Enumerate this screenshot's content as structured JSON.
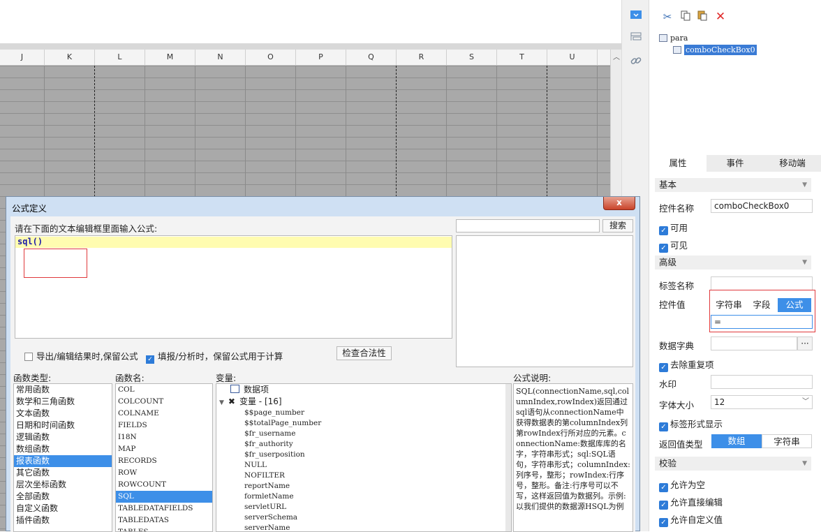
{
  "sheet": {
    "columns": [
      "J",
      "K",
      "L",
      "M",
      "N",
      "O",
      "P",
      "Q",
      "R",
      "S",
      "T",
      "U"
    ]
  },
  "middle_toolbar": {
    "icons": [
      "combo-widget-icon",
      "widget-list-icon",
      "link-icon"
    ]
  },
  "right_panel": {
    "toolbar_icons": [
      "cut-icon",
      "copy-icon",
      "paste-icon",
      "delete-icon"
    ],
    "tree": {
      "root": "para",
      "child": "comboCheckBox0"
    },
    "tabs": [
      "属性",
      "事件",
      "移动端"
    ],
    "basic": {
      "section": "基本",
      "name_label": "控件名称",
      "name_value": "comboCheckBox0",
      "enabled": "可用",
      "visible": "可见"
    },
    "advanced": {
      "section": "高级",
      "tag_name_label": "标签名称",
      "control_value_label": "控件值",
      "value_modes": [
        "字符串",
        "字段",
        "公式"
      ],
      "formula_value": "=",
      "dict_label": "数据字典",
      "dict_button": "···",
      "dedupe": "去除重复项",
      "watermark_label": "水印",
      "font_size_label": "字体大小",
      "font_size_value": "12",
      "tag_display": "标签形式显示",
      "return_type_label": "返回值类型",
      "return_types": [
        "数组",
        "字符串"
      ]
    },
    "validation": {
      "section": "校验",
      "allow_empty": "允许为空",
      "allow_edit": "允许直接编辑",
      "allow_custom": "允许自定义值"
    }
  },
  "dialog": {
    "title": "公式定义",
    "close": "x",
    "prompt": "请在下面的文本编辑框里面输入公式:",
    "formula": "sql()",
    "search_button": "搜索",
    "keep_formula_export": "导出/编辑结果时,保留公式",
    "keep_formula_fill": "填报/分析时，保留公式用于计算",
    "check_button": "检查合法性",
    "function_types_label": "函数类型:",
    "function_types": [
      "常用函数",
      "数学和三角函数",
      "文本函数",
      "日期和时间函数",
      "逻辑函数",
      "数组函数",
      "报表函数",
      "其它函数",
      "层次坐标函数",
      "全部函数",
      "自定义函数",
      "插件函数"
    ],
    "function_names_label": "函数名:",
    "function_names": [
      "COL",
      "COLCOUNT",
      "COLNAME",
      "FIELDS",
      "I18N",
      "MAP",
      "RECORDS",
      "ROW",
      "ROWCOUNT",
      "SQL",
      "TABLEDATAFIELDS",
      "TABLEDATAS",
      "TABLES"
    ],
    "variables_label": "变量:",
    "variables_data_item": "数据项",
    "variables_group": "变量 - [16]",
    "variables": [
      "$$page_number",
      "$$totalPage_number",
      "$fr_username",
      "$fr_authority",
      "$fr_userposition",
      "NULL",
      "NOFILTER",
      "reportName",
      "formletName",
      "servletURL",
      "serverSchema",
      "serverName"
    ],
    "description_label": "公式说明:",
    "description": "SQL(connectionName,sql,columnIndex,rowIndex)返回通过sql语句从connectionName中获得数据表的第columnIndex列第rowIndex行所对应的元素。connectionName:数据库库的名字，字符串形式；sql:SQL语句，字符串形式；columnIndex:列序号，整形；rowIndex:行序号，整形。备注:行序号可以不写，这样返回值为数据列。示例:以我们提供的数据源HSQL为例"
  }
}
